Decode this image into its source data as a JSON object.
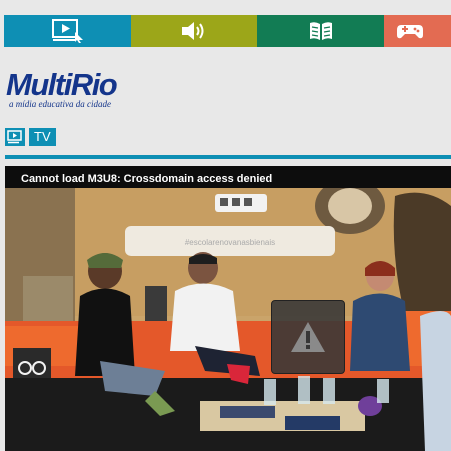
{
  "nav": {
    "tabs": [
      {
        "name": "tv",
        "icon": "video-play-icon",
        "color": "#0e8fb4"
      },
      {
        "name": "audio",
        "icon": "speaker-icon",
        "color": "#9ca619"
      },
      {
        "name": "reading",
        "icon": "book-icon",
        "color": "#127c54"
      },
      {
        "name": "games",
        "icon": "gamepad-icon",
        "color": "#e36b52"
      }
    ]
  },
  "logo": {
    "main": "MultiRio",
    "tagline": "a mídia educativa da cidade"
  },
  "section": {
    "label": "TV",
    "icon": "tv-play-icon"
  },
  "player": {
    "error_message": "Cannot load M3U8: Crossdomain access denied",
    "warning_icon": "warning-triangle-icon",
    "studio_banner": "#escolarenovanasbienais"
  },
  "colors": {
    "brand_blue": "#14358b",
    "accent": "#0e8fb4"
  }
}
